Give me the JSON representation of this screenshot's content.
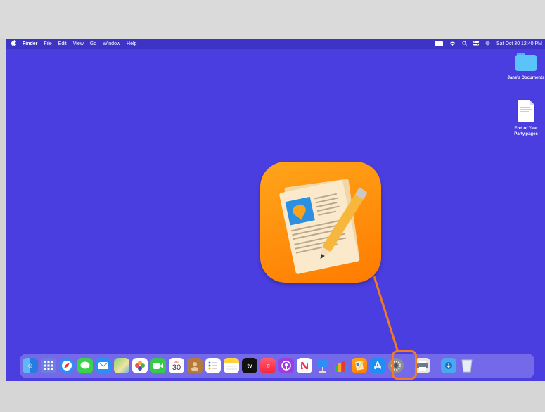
{
  "menubar": {
    "apple_icon": "apple-icon",
    "items": [
      "Finder",
      "File",
      "Edit",
      "View",
      "Go",
      "Window",
      "Help"
    ],
    "status_icons": [
      "battery-icon",
      "wifi-icon",
      "search-icon",
      "control-center-icon",
      "siri-icon"
    ],
    "datetime": "Sat Oct 30  12:40 PM"
  },
  "desktop": {
    "folder_label": "Jane's Documents",
    "file_label_line1": "End of Year",
    "file_label_line2": "Party.pages",
    "background_color": "#4a3ee0"
  },
  "featured_app": {
    "icon": "pages-app-icon",
    "accent_color": "#ff8a00"
  },
  "dock": {
    "calendar_month": "OCT",
    "calendar_day": "30",
    "tv_label": "tv",
    "highlighted_app": "pages-icon",
    "highlight_color": "#f47a20"
  }
}
